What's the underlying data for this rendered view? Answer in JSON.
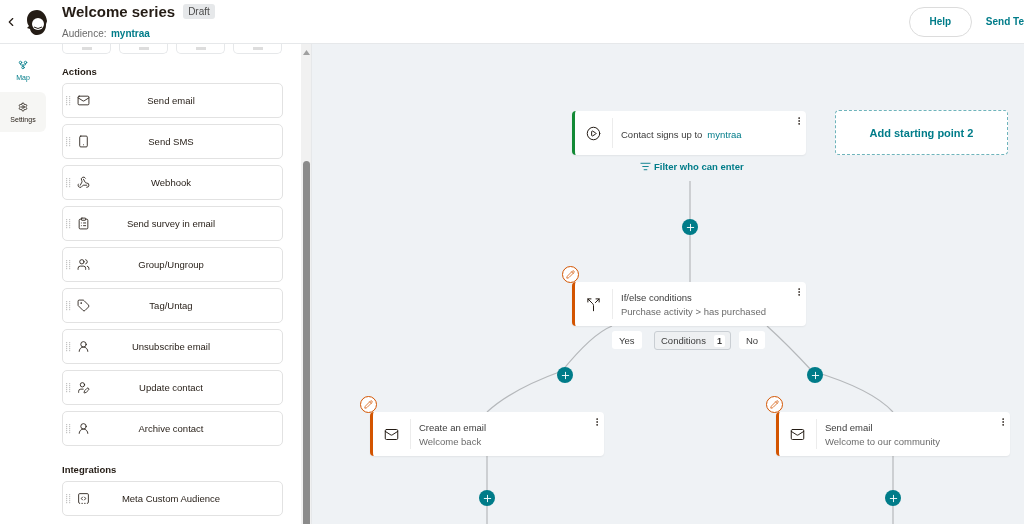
{
  "header": {
    "title": "Welcome series",
    "status": "Draft",
    "audience_label": "Audience:",
    "audience": "myntraa",
    "help": "Help",
    "send_test": "Send Te"
  },
  "rail": [
    {
      "label": "Map",
      "kind": "map",
      "selected": true
    },
    {
      "label": "Settings",
      "kind": "settings",
      "selected": false
    }
  ],
  "panel": {
    "sections": [
      {
        "heading": "Actions",
        "items": [
          {
            "label": "Send email",
            "kind": "email"
          },
          {
            "label": "Send SMS",
            "kind": "sms"
          },
          {
            "label": "Webhook",
            "kind": "webhook"
          },
          {
            "label": "Send survey in email",
            "kind": "survey"
          },
          {
            "label": "Group/Ungroup",
            "kind": "group"
          },
          {
            "label": "Tag/Untag",
            "kind": "tag"
          },
          {
            "label": "Unsubscribe email",
            "kind": "person"
          },
          {
            "label": "Update contact",
            "kind": "update"
          },
          {
            "label": "Archive contact",
            "kind": "person"
          }
        ]
      },
      {
        "heading": "Integrations",
        "items": [
          {
            "label": "Meta Custom Audience",
            "kind": "meta"
          }
        ]
      }
    ]
  },
  "canvas": {
    "trigger": {
      "text": "Contact signs up to",
      "link": "myntraa",
      "needs_attention": false
    },
    "add_start": "Add starting point 2",
    "filter": "Filter who can enter",
    "condition": {
      "title": "If/else conditions",
      "subtitle": "Purchase activity > has purchased",
      "needs_attention": true
    },
    "branches": {
      "yes": "Yes",
      "no": "No",
      "conditions": "Conditions",
      "count": "1"
    },
    "steps": [
      {
        "title": "Create an email",
        "subtitle": "Welcome back",
        "needs_attention": true
      },
      {
        "title": "Send email",
        "subtitle": "Welcome to our community",
        "needs_attention": true
      }
    ]
  }
}
